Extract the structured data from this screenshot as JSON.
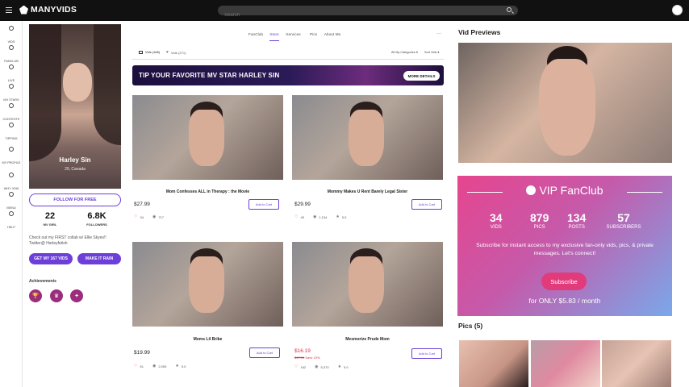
{
  "topbar": {
    "logo": "MANYVIDS",
    "search_placeholder": "Search"
  },
  "leftnav": [
    {
      "label": "VIDS",
      "icon": "play-icon"
    },
    {
      "label": "FANCLUB",
      "icon": "heart-icon"
    },
    {
      "label": "LIVE",
      "icon": "live-icon"
    },
    {
      "label": "MV STARS",
      "icon": "star-icon"
    },
    {
      "label": "CONTESTS",
      "icon": "trophy-icon"
    },
    {
      "label": "TIPPING",
      "icon": "cursor-icon"
    },
    {
      "label": "MY PROFILE",
      "icon": "user-icon"
    },
    {
      "label": "WHY JOIN",
      "icon": "heart-icon"
    },
    {
      "label": "MENU",
      "icon": "menu-icon"
    },
    {
      "label": "HELP",
      "icon": "help-icon"
    }
  ],
  "profile": {
    "name": "Harley Sin",
    "location": "29, Canada",
    "follow_label": "FOLLOW FOR FREE",
    "stats": [
      {
        "value": "22",
        "label": "MV GIRL"
      },
      {
        "value": "6.8K",
        "label": "FOLLOWERS"
      }
    ],
    "bio": "Check out my FIRST collab w/ Ellie Skyes!! Twitter@ Harleyfetish",
    "get_vids_label": "GET MY 167 VIDS",
    "make_rain_label": "MAKE IT RAIN",
    "achievements_title": "Achievements"
  },
  "content_tabs": [
    "FanClub",
    "Store",
    "Services",
    "Pics",
    "About Me"
  ],
  "active_tab": "Store",
  "subtabs": {
    "vids_label": "Vids (166)",
    "likes_label": "Vote (271)",
    "category_label": "All My Categories",
    "sort_label": "Sort Vids"
  },
  "banner": {
    "text": "TIP YOUR FAVORITE MV STAR HARLEY SIN",
    "button_label": "MORE DETAILS"
  },
  "videos": [
    {
      "title": "Mom Confesses ALL in Therapy : the Movie",
      "price": "$27.99",
      "orig_price": "",
      "sale_note": "",
      "likes": "34",
      "views": "717",
      "rating": "",
      "button": "Add to Cart"
    },
    {
      "title": "Mommy Makes U Rent Barely Legal Sister",
      "price": "$29.99",
      "orig_price": "",
      "sale_note": "",
      "likes": "45",
      "views": "1,134",
      "rating": "5.0",
      "button": "Add to Cart"
    },
    {
      "title": "Moms Lil Bribe",
      "price": "$19.99",
      "orig_price": "",
      "sale_note": "",
      "likes": "61",
      "views": "2,005",
      "rating": "5.0",
      "button": "Add to Cart"
    },
    {
      "title": "Mesmorize Prude Mom",
      "price": "$16.19",
      "orig_price": "$17.99",
      "sale_note": "Save 10%",
      "likes": "162",
      "views": "5,370",
      "rating": "5.0",
      "button": "Add to Cart"
    }
  ],
  "right_panel": {
    "previews_title": "Vid Previews",
    "vip": {
      "title": "VIP FanClub",
      "stats": [
        {
          "value": "34",
          "label": "VIDS"
        },
        {
          "value": "879",
          "label": "PICS"
        },
        {
          "value": "134",
          "label": "POSTS"
        },
        {
          "value": "57",
          "label": "SUBSCRIBERS"
        }
      ],
      "description": "Subscribe for instant access to my exclusive fan-only vids, pics, & private messages. Let's connect!",
      "button_label": "Subscribe",
      "price": "for ONLY $5.83 / month"
    },
    "pics_title": "Pics (5)"
  },
  "colors": {
    "accent": "#6d3fd8",
    "sale": "#d6334f",
    "topbar": "#111111"
  }
}
